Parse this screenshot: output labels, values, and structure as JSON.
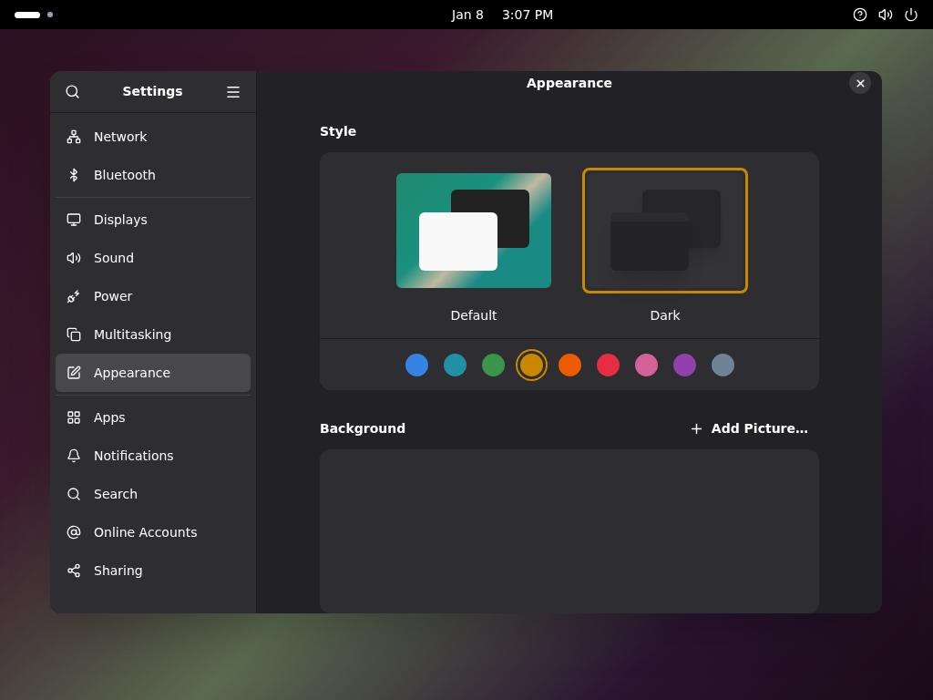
{
  "top_bar": {
    "date": "Jan 8",
    "time": "3:07 PM"
  },
  "window": {
    "title": "Settings",
    "page_title": "Appearance"
  },
  "sidebar": {
    "groups": [
      [
        {
          "label": "Network",
          "selected": false
        },
        {
          "label": "Bluetooth",
          "selected": false
        }
      ],
      [
        {
          "label": "Displays",
          "selected": false
        },
        {
          "label": "Sound",
          "selected": false
        },
        {
          "label": "Power",
          "selected": false
        },
        {
          "label": "Multitasking",
          "selected": false
        },
        {
          "label": "Appearance",
          "selected": true
        }
      ],
      [
        {
          "label": "Apps",
          "selected": false
        },
        {
          "label": "Notifications",
          "selected": false
        },
        {
          "label": "Search",
          "selected": false
        },
        {
          "label": "Online Accounts",
          "selected": false
        },
        {
          "label": "Sharing",
          "selected": false
        }
      ]
    ]
  },
  "style": {
    "heading": "Style",
    "options": [
      {
        "label": "Default",
        "kind": "light",
        "selected": false
      },
      {
        "label": "Dark",
        "kind": "dark",
        "selected": true
      }
    ],
    "accents": [
      {
        "color": "#3584e4",
        "selected": false
      },
      {
        "color": "#2190a4",
        "selected": false
      },
      {
        "color": "#3a944a",
        "selected": false
      },
      {
        "color": "#c88800",
        "selected": true
      },
      {
        "color": "#ed5b00",
        "selected": false
      },
      {
        "color": "#e62d42",
        "selected": false
      },
      {
        "color": "#d56199",
        "selected": false
      },
      {
        "color": "#9141ac",
        "selected": false
      },
      {
        "color": "#6f8396",
        "selected": false
      }
    ]
  },
  "background": {
    "heading": "Background",
    "add_button": "Add Picture…"
  }
}
